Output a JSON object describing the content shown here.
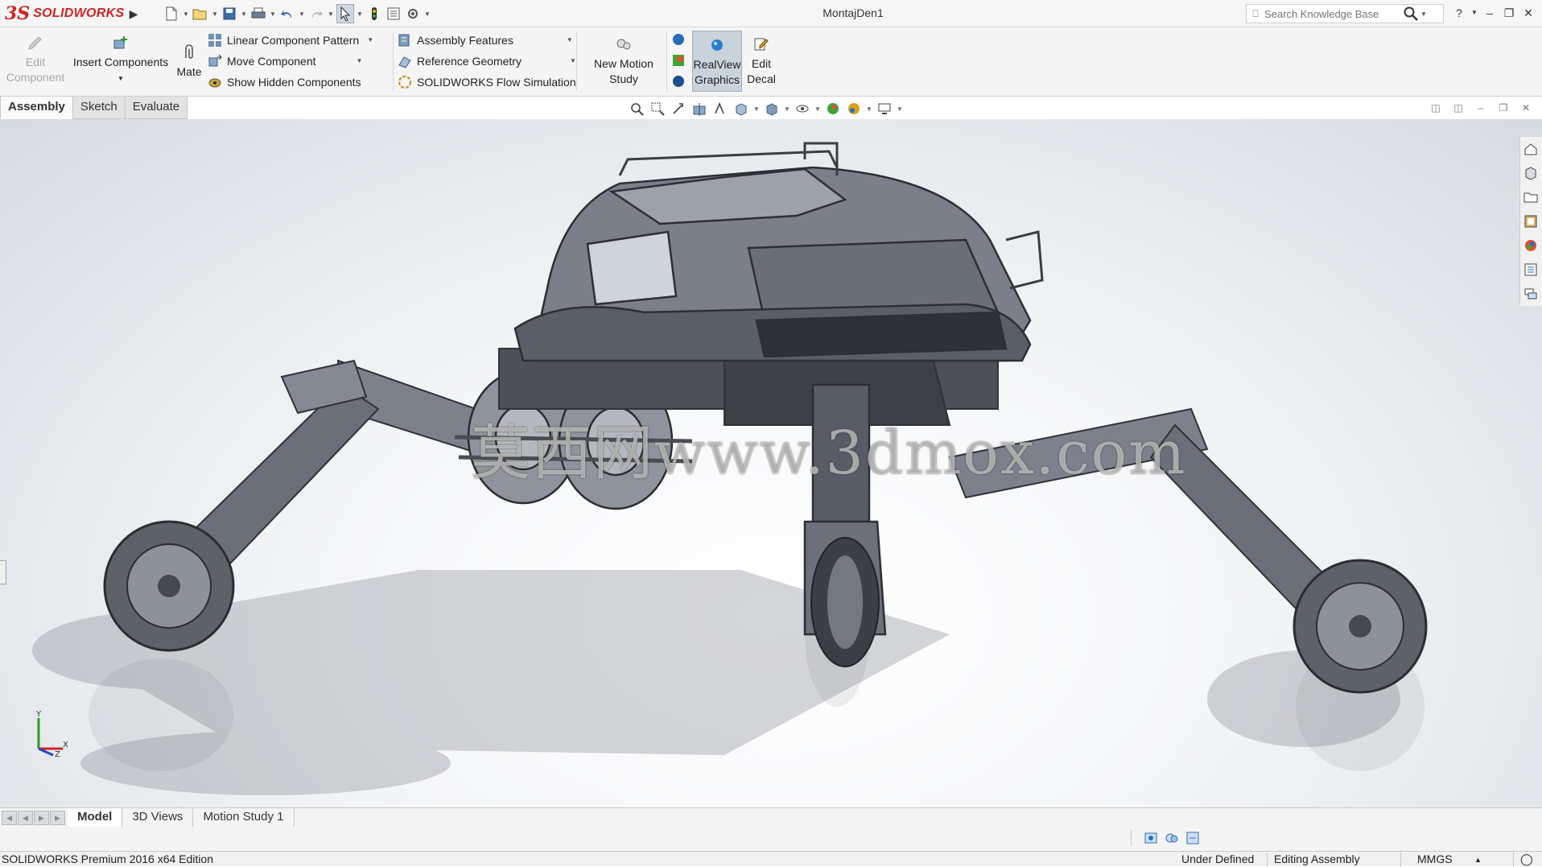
{
  "app": {
    "brand_mark": "3S",
    "brand_name": "SOLIDWORKS",
    "document_title": "MontajDen1"
  },
  "search": {
    "placeholder": "Search Knowledge Base"
  },
  "ribbon": {
    "edit_component_line1": "Edit",
    "edit_component_line2": "Component",
    "insert_components": "Insert Components",
    "mate": "Mate",
    "linear_pattern": "Linear Component Pattern",
    "move_component": "Move Component",
    "show_hidden": "Show Hidden Components",
    "assembly_features": "Assembly Features",
    "reference_geometry": "Reference Geometry",
    "flow_simulation": "SOLIDWORKS Flow Simulation",
    "new_motion_line1": "New Motion",
    "new_motion_line2": "Study",
    "realview_line1": "RealView",
    "realview_line2": "Graphics",
    "edit_decal_line1": "Edit",
    "edit_decal_line2": "Decal"
  },
  "tabs": [
    "Assembly",
    "Sketch",
    "Evaluate"
  ],
  "watermark": "莫西网www.3dmox.com",
  "triad": {
    "y": "Y",
    "x": "X",
    "z": "Z"
  },
  "bottom_tabs": [
    "Model",
    "3D Views",
    "Motion Study 1"
  ],
  "status": {
    "edition": "SOLIDWORKS Premium 2016 x64 Edition",
    "definition": "Under Defined",
    "mode": "Editing Assembly",
    "units": "MMGS"
  },
  "colors": {
    "brand_red": "#d02323",
    "model_gray": "#6f737d",
    "active_button": "#c9d3dc"
  }
}
